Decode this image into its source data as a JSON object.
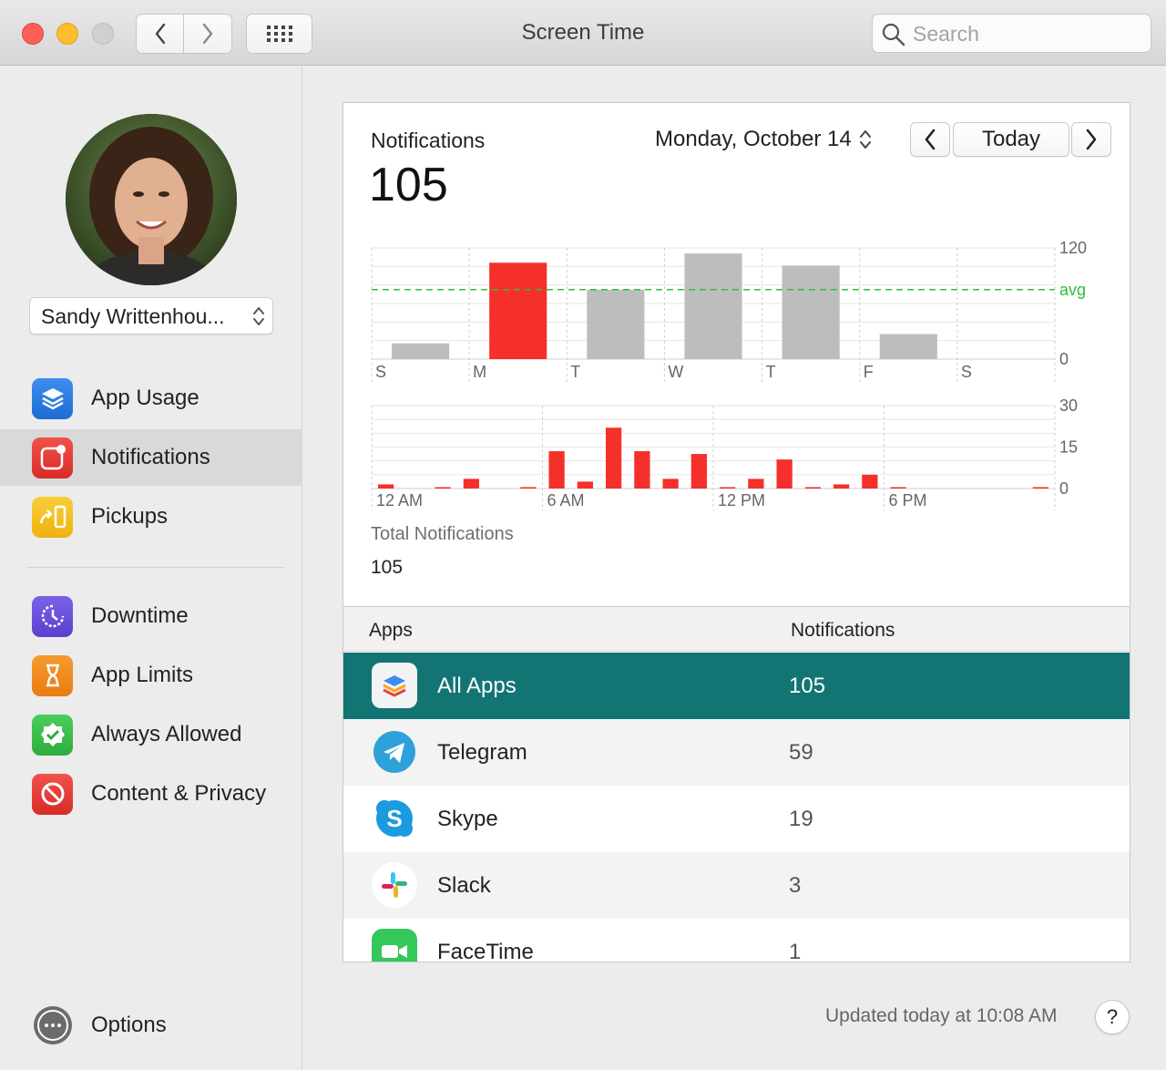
{
  "window": {
    "title": "Screen Time",
    "search_placeholder": "Search"
  },
  "sidebar": {
    "user_name": "Sandy Writtenhou...",
    "items": [
      {
        "label": "App Usage",
        "icon": "layers-icon",
        "color": "#2d7ee0"
      },
      {
        "label": "Notifications",
        "icon": "notification-badge-icon",
        "color": "#e83d3a",
        "selected": true
      },
      {
        "label": "Pickups",
        "icon": "pickup-arrow-icon",
        "color": "#f3bc1e"
      },
      {
        "label": "Downtime",
        "icon": "downtime-clock-icon",
        "color": "#6a4fdb"
      },
      {
        "label": "App Limits",
        "icon": "hourglass-icon",
        "color": "#f08a1c"
      },
      {
        "label": "Always Allowed",
        "icon": "checkmark-badge-icon",
        "color": "#3fbf4f"
      },
      {
        "label": "Content & Privacy",
        "icon": "prohibited-icon",
        "color": "#e83d3a"
      }
    ],
    "options_label": "Options"
  },
  "main": {
    "header_title": "Notifications",
    "total": "105",
    "date": "Monday, October 14",
    "today_label": "Today",
    "total_label": "Total Notifications",
    "total_value": "105",
    "table": {
      "col_apps": "Apps",
      "col_notifications": "Notifications",
      "rows": [
        {
          "name": "All Apps",
          "count": "105",
          "icon": "stack-icon"
        },
        {
          "name": "Telegram",
          "count": "59",
          "icon": "telegram-icon"
        },
        {
          "name": "Skype",
          "count": "19",
          "icon": "skype-icon"
        },
        {
          "name": "Slack",
          "count": "3",
          "icon": "slack-icon"
        },
        {
          "name": "FaceTime",
          "count": "1",
          "icon": "facetime-icon"
        }
      ]
    },
    "updated_text": "Updated today at 10:08 AM",
    "help_label": "?"
  },
  "chart_data": [
    {
      "type": "bar",
      "categories": [
        "S",
        "M",
        "T",
        "W",
        "T",
        "F",
        "S"
      ],
      "values": [
        17,
        104,
        75,
        114,
        101,
        27,
        0
      ],
      "highlight_index": 1,
      "ylim": [
        0,
        120
      ],
      "ytick_labels": [
        "120",
        "avg",
        "0"
      ],
      "avg": 75,
      "colors": {
        "bar": "#bdbdbd",
        "highlight": "#f5302a",
        "avg_line": "#2fbf3a"
      }
    },
    {
      "type": "bar",
      "x_labels": [
        "12 AM",
        "6 AM",
        "12 PM",
        "6 PM"
      ],
      "values": [
        1.5,
        0,
        0.5,
        3.5,
        0,
        0.5,
        13.5,
        2.5,
        22,
        13.5,
        3.5,
        12.5,
        0.5,
        3.5,
        10.5,
        0.5,
        1.5,
        5,
        0.5,
        0,
        0,
        0,
        0,
        0.5
      ],
      "ylim": [
        0,
        30
      ],
      "yticks": [
        "30",
        "15",
        "0"
      ],
      "color": "#f5302a"
    }
  ]
}
